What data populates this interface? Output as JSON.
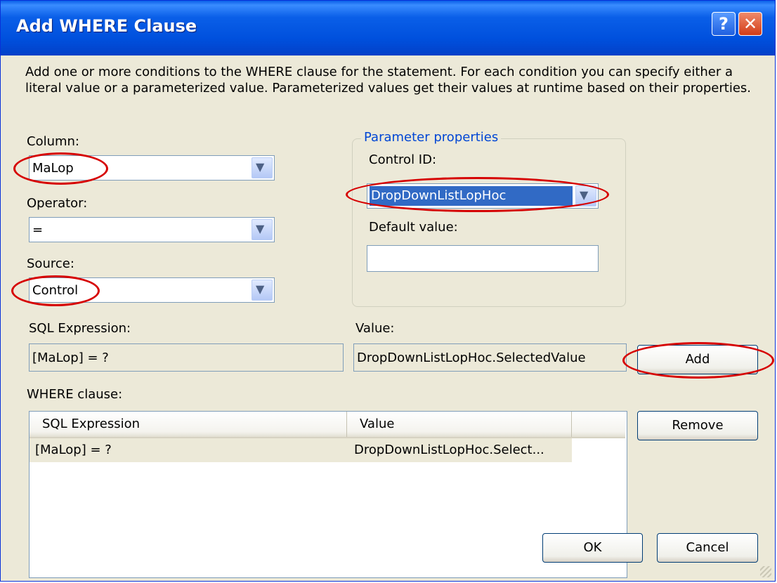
{
  "window": {
    "title": "Add WHERE Clause",
    "help_glyph": "?",
    "close_glyph": "✕"
  },
  "description": "Add one or more conditions to the WHERE clause for the statement. For each condition you can specify either a literal value or a parameterized value. Parameterized values get their values at runtime based on their properties.",
  "column": {
    "label": "Column:",
    "value": "MaLop"
  },
  "operator": {
    "label": "Operator:",
    "value": "="
  },
  "source": {
    "label": "Source:",
    "value": "Control"
  },
  "parameter_properties": {
    "title": "Parameter properties",
    "control_id_label": "Control ID:",
    "control_id_value": "DropDownListLopHoc",
    "default_value_label": "Default value:",
    "default_value": ""
  },
  "sql_expression": {
    "label": "SQL Expression:",
    "value": "[MaLop] = ?"
  },
  "value": {
    "label": "Value:",
    "value": "DropDownListLopHoc.SelectedValue"
  },
  "buttons": {
    "add": "Add",
    "remove": "Remove",
    "ok": "OK",
    "cancel": "Cancel"
  },
  "where_clause": {
    "label": "WHERE clause:",
    "columns": [
      "SQL Expression",
      "Value"
    ],
    "rows": [
      {
        "expression": "[MaLop] = ?",
        "value": "DropDownListLopHoc.Select..."
      }
    ]
  },
  "icons": {
    "dropdown": "▼"
  },
  "colors": {
    "titlebar": "#0a5fe8",
    "highlight": "#316ac5",
    "annotation": "#d60000",
    "group_title": "#0046d5"
  }
}
